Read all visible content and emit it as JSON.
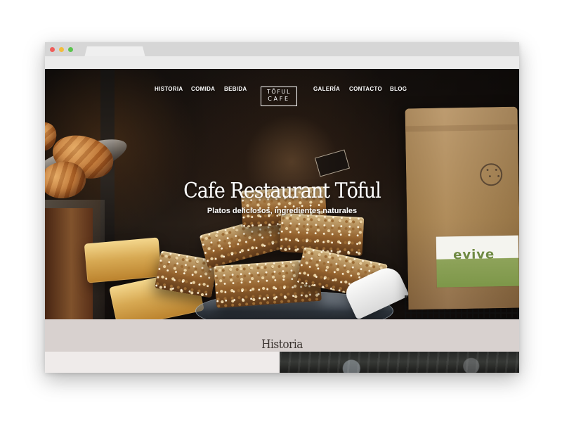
{
  "site": {
    "navigation": {
      "left_links": [
        "HISTORIA",
        "COMIDA",
        "BEBIDA"
      ],
      "right_links": [
        "GALERÍA",
        "CONTACTO",
        "BLOG"
      ]
    },
    "logo": {
      "line_1": "TŌFUL",
      "line_2": "CAFE"
    },
    "hero": {
      "title": "Cafe Restaurant Tōful",
      "subtitle": "Platos deliciosos, ingredientes naturales"
    },
    "product_bag": {
      "label_text": "evive"
    },
    "section": {
      "title": "Historia"
    }
  },
  "theme": {
    "section_background": "#d8d1cf",
    "content_background": "#efebea",
    "chrome_background": "#d6d6d6",
    "window_controls": [
      "#ef5d5a",
      "#f3bd3c",
      "#5ac44e"
    ]
  },
  "icons": [
    "close-dot-icon",
    "minimize-dot-icon",
    "maximize-dot-icon",
    "coffee-logo-icon"
  ]
}
